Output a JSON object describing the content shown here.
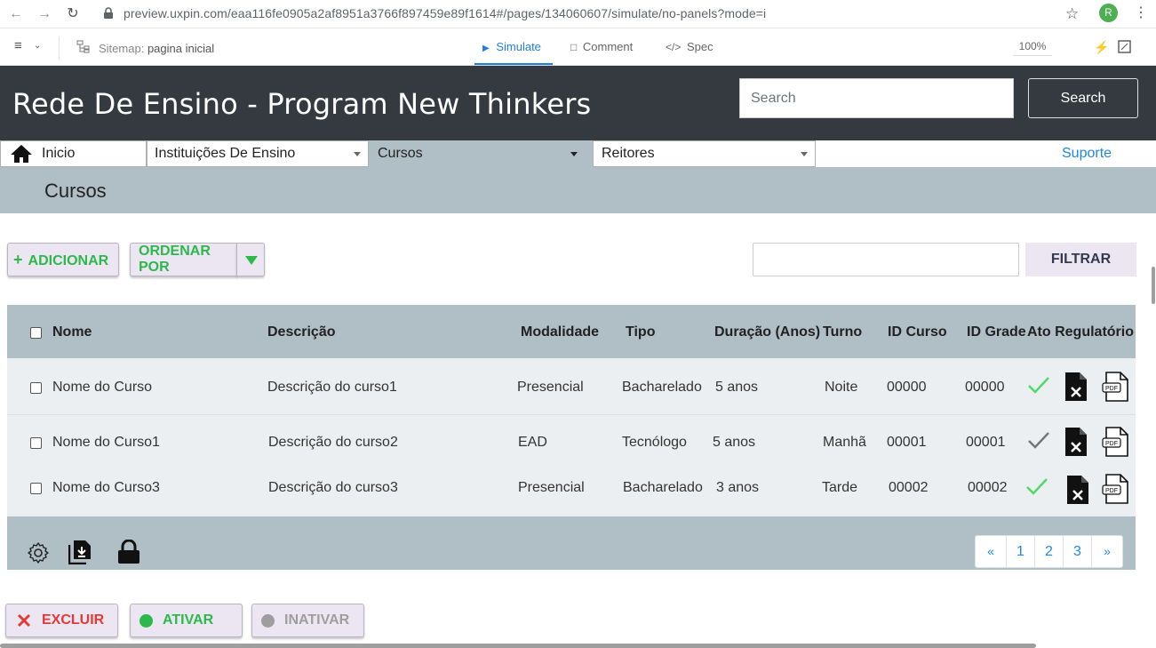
{
  "browser": {
    "url": "preview.uxpin.com/eaa116fe0905a2af8951a3766f897459e89f1614#/pages/134060607/simulate/no-panels?mode=i",
    "profile_initial": "R"
  },
  "uxpin": {
    "sitemap_label": "Sitemap:",
    "sitemap_page": "pagina inicial",
    "tabs": {
      "simulate": "Simulate",
      "comment": "Comment",
      "spec": "Spec"
    },
    "zoom": "100%"
  },
  "header": {
    "title": "Rede De Ensino - Program New Thinkers",
    "search_placeholder": "Search",
    "search_button": "Search"
  },
  "nav": {
    "inicio": "Inicio",
    "instituicoes": "Instituições De Ensino",
    "cursos": "Cursos",
    "reitores": "Reitores",
    "suporte": "Suporte"
  },
  "page": {
    "title": "Cursos"
  },
  "actions": {
    "adicionar": "ADICIONAR",
    "ordenar": "ORDENAR POR",
    "filtrar": "FILTRAR"
  },
  "table": {
    "columns": {
      "nome": "Nome",
      "descricao": "Descrição",
      "modalidade": "Modalidade",
      "tipo": "Tipo",
      "duracao": "Duração (Anos)",
      "turno": "Turno",
      "id_curso": "ID Curso",
      "id_grade": "ID Grade",
      "ato": "Ato Regulatório"
    },
    "rows": [
      {
        "nome": "Nome do Curso",
        "descricao": "Descrição do curso1",
        "modalidade": "Presencial",
        "tipo": "Bacharelado",
        "duracao": "5 anos",
        "turno": "Noite",
        "id_curso": "00000",
        "id_grade": "00000",
        "check_color": "#4cd964"
      },
      {
        "nome": "Nome do Curso1",
        "descricao": "Descrição do curso2",
        "modalidade": "EAD",
        "tipo": "Tecnólogo",
        "duracao": "5 anos",
        "turno": "Manhã",
        "id_curso": "00001",
        "id_grade": "00001",
        "check_color": "#757575"
      },
      {
        "nome": "Nome do Curso3",
        "descricao": "Descrição do curso3",
        "modalidade": "Presencial",
        "tipo": "Bacharelado",
        "duracao": "3 anos",
        "turno": "Tarde",
        "id_curso": "00002",
        "id_grade": "00002",
        "check_color": "#4cd964"
      }
    ]
  },
  "pagination": {
    "prev": "«",
    "pages": [
      "1",
      "2",
      "3"
    ],
    "next": "»"
  },
  "bottom_actions": {
    "excluir": "EXCLUIR",
    "ativar": "ATIVAR",
    "inativar": "INATIVAR"
  },
  "icons": {
    "footer": [
      "gear-icon",
      "file-download-icon",
      "lock-icon"
    ],
    "row_actions": [
      "check-icon",
      "file-delete-icon",
      "pdf-icon"
    ]
  },
  "colors": {
    "header_bg": "#343a40",
    "nav_band": "#b0bec5",
    "accent_green": "#2db84c",
    "danger_red": "#e53935",
    "link_blue": "#1e88e5"
  }
}
